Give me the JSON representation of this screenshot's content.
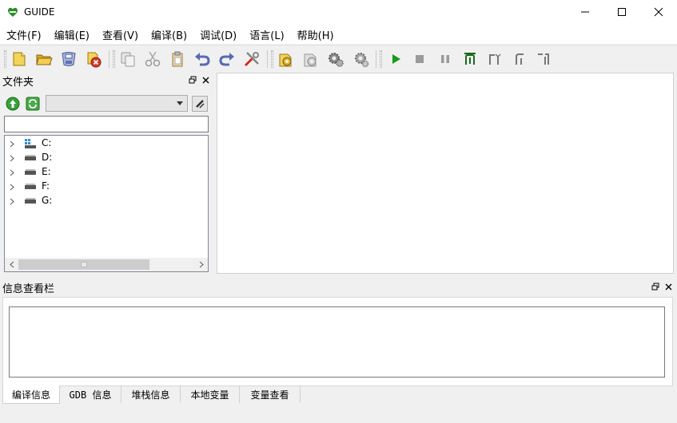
{
  "window": {
    "title": "GUIDE",
    "brand_color": "#2e8b2e",
    "controls": [
      "minimize-icon",
      "maximize-icon",
      "close-icon"
    ]
  },
  "menu": {
    "items": [
      {
        "label": "文件(F)"
      },
      {
        "label": "编辑(E)"
      },
      {
        "label": "查看(V)"
      },
      {
        "label": "编译(B)"
      },
      {
        "label": "调试(D)"
      },
      {
        "label": "语言(L)"
      },
      {
        "label": "帮助(H)"
      }
    ]
  },
  "toolbar": {
    "file_icons": [
      "new-file-icon",
      "open-folder-icon",
      "save-icon",
      "close-file-icon"
    ],
    "edit_icons": [
      "copy-icon",
      "cut-icon",
      "paste-icon",
      "undo-icon",
      "redo-icon",
      "tools-icon"
    ],
    "build_icons": [
      "compile-icon",
      "build-icon",
      "settings-gear-icon",
      "settings-gear-alt-icon"
    ],
    "debug_icons": [
      "run-icon",
      "stop-icon",
      "pause-icon",
      "step-into-icon",
      "step-over-icon",
      "step-out-icon",
      "run-to-cursor-icon"
    ],
    "accent_green": "#1a9a1a"
  },
  "folder_panel": {
    "title": "文件夹",
    "combo_value": "",
    "path_value": "",
    "drives": [
      {
        "label": "C:",
        "icon": "system-drive-icon"
      },
      {
        "label": "D:",
        "icon": "drive-icon"
      },
      {
        "label": "E:",
        "icon": "drive-icon"
      },
      {
        "label": "F:",
        "icon": "drive-icon"
      },
      {
        "label": "G:",
        "icon": "drive-icon"
      }
    ]
  },
  "info_panel": {
    "title": "信息查看栏",
    "tabs": [
      {
        "label": "编译信息",
        "active": true
      },
      {
        "label": "GDB 信息",
        "active": false
      },
      {
        "label": "堆栈信息",
        "active": false
      },
      {
        "label": "本地变量",
        "active": false
      },
      {
        "label": "变量查看",
        "active": false
      }
    ]
  }
}
